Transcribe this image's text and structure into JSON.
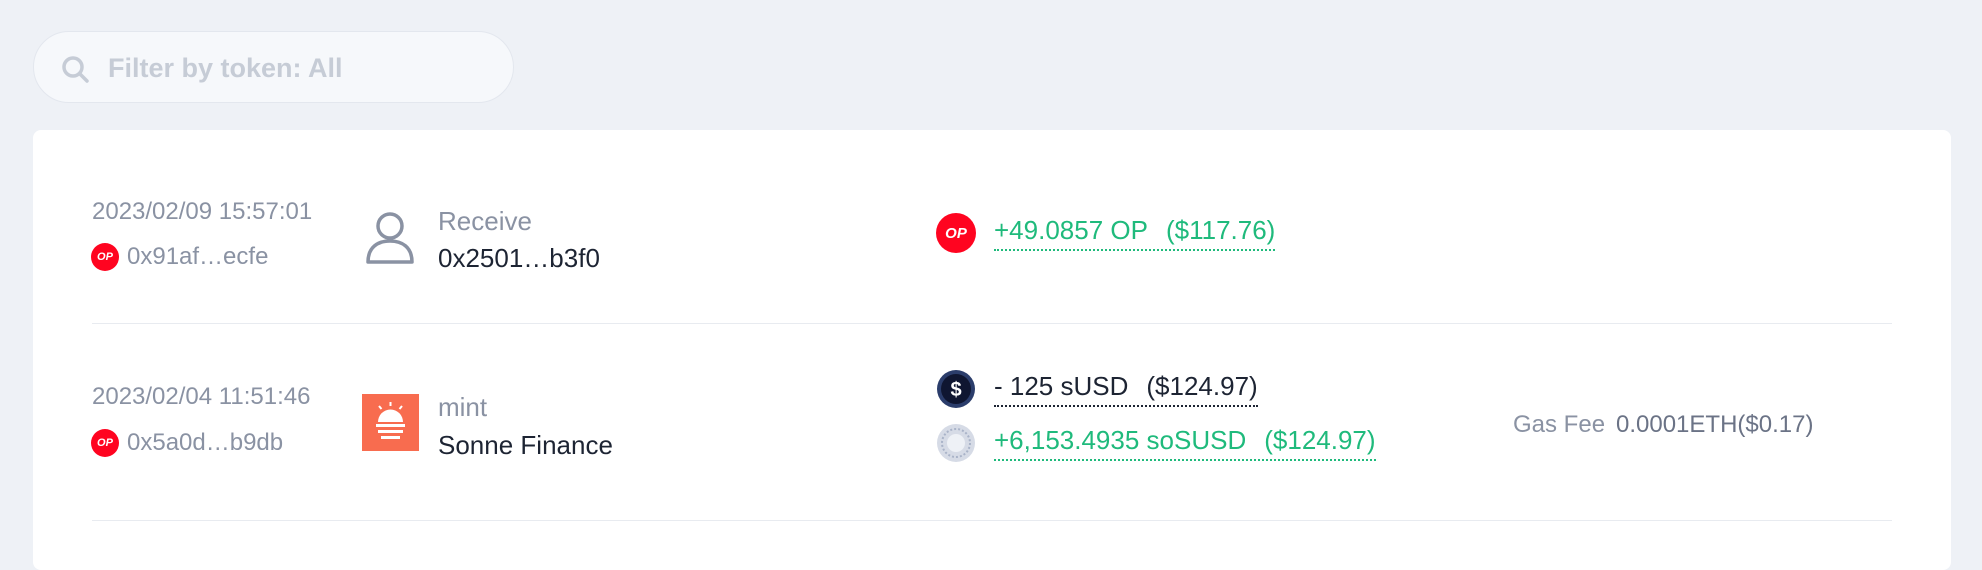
{
  "filter": {
    "placeholder": "Filter by token: All"
  },
  "transactions": [
    {
      "time": "2023/02/09 15:57:01",
      "chain_badge": "OP",
      "tx_address": "0x91af…ecfe",
      "type_label": "Receive",
      "counterparty": "0x2501…b3f0",
      "tokens": [
        {
          "icon": "op-token-icon",
          "badge": "OP",
          "amount": "+49.0857 OP",
          "usd": "($117.76)",
          "color": "#1fba7c"
        }
      ]
    },
    {
      "time": "2023/02/04 11:51:46",
      "chain_badge": "OP",
      "tx_address": "0x5a0d…b9db",
      "type_label": "mint",
      "counterparty": "Sonne Finance",
      "tokens": [
        {
          "icon": "susd-token-icon",
          "amount": "- 125 sUSD",
          "usd": "($124.97)",
          "color": "#1d2433"
        },
        {
          "icon": "sosusd-token-icon",
          "amount": "+6,153.4935 soSUSD",
          "usd": "($124.97)",
          "color": "#1fba7c"
        }
      ],
      "gas_fee_label": "Gas Fee",
      "gas_fee_value": "0.0001ETH($0.17)"
    }
  ]
}
